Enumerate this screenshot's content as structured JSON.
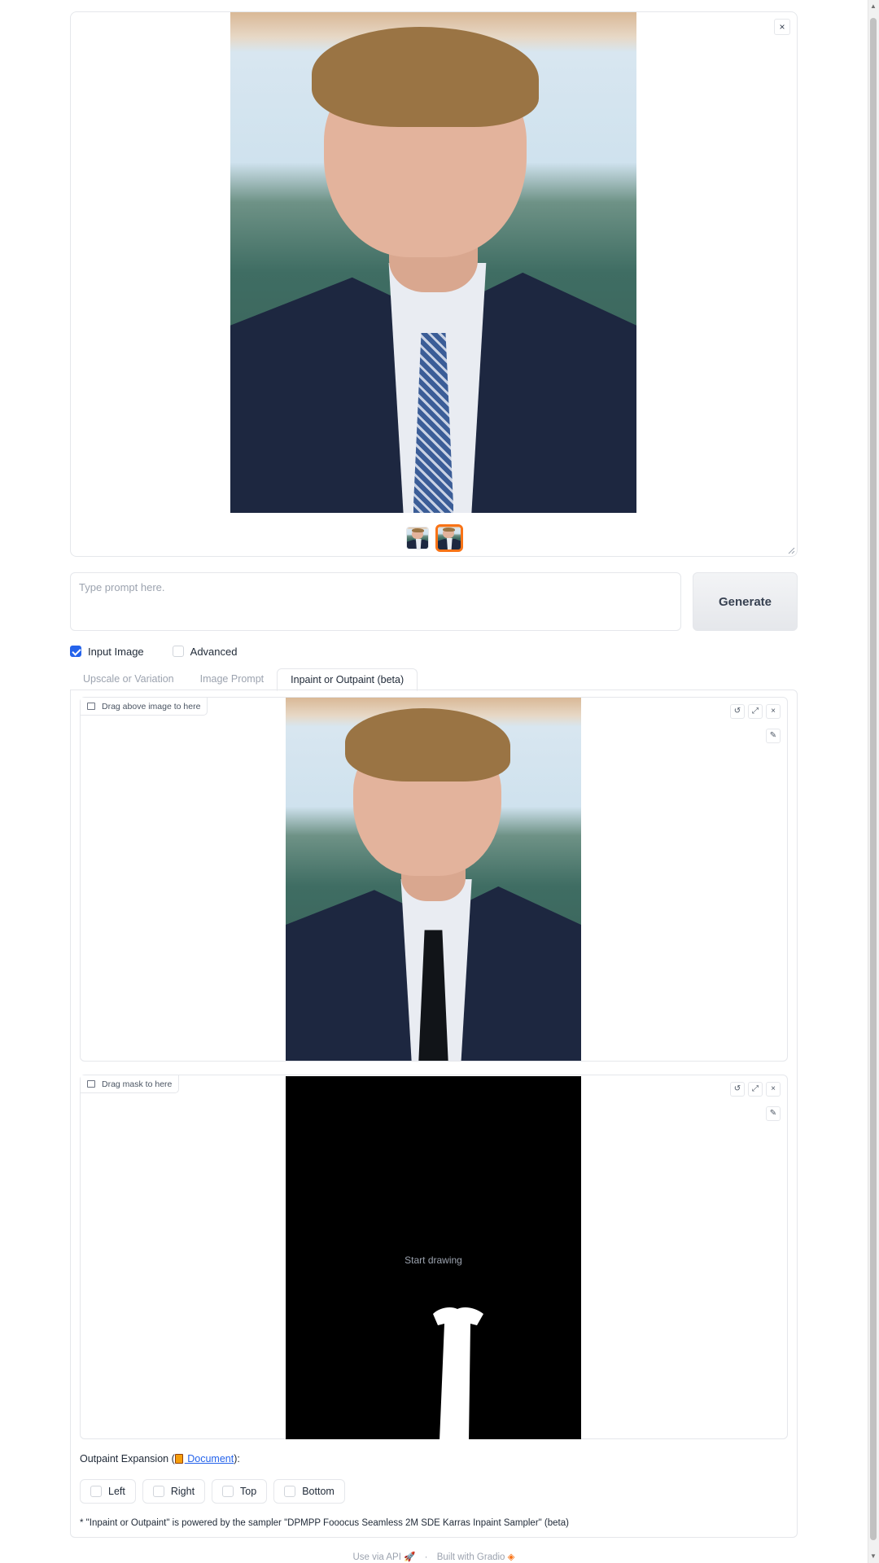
{
  "gallery": {
    "close_label": "×",
    "thumbnails": [
      "thumb-1",
      "thumb-2"
    ]
  },
  "prompt": {
    "placeholder": "Type prompt here."
  },
  "generate_label": "Generate",
  "options": {
    "input_image_label": "Input Image",
    "input_image_checked": true,
    "advanced_label": "Advanced",
    "advanced_checked": false
  },
  "tabs": [
    {
      "label": "Upscale or Variation",
      "active": false
    },
    {
      "label": "Image Prompt",
      "active": false
    },
    {
      "label": "Inpaint or Outpaint (beta)",
      "active": true
    }
  ],
  "image_editor": {
    "label": "Drag above image to here"
  },
  "mask_editor": {
    "label": "Drag mask to here",
    "hint": "Start drawing"
  },
  "outpaint": {
    "prefix": "Outpaint Expansion (",
    "link_label": " Document",
    "suffix": "):",
    "options": [
      "Left",
      "Right",
      "Top",
      "Bottom"
    ]
  },
  "footnote": "* \"Inpaint or Outpaint\" is powered by the sampler \"DPMPP Fooocus Seamless 2M SDE Karras Inpaint Sampler\" (beta)",
  "footer": {
    "api_label": "Use via API",
    "sep": "·",
    "built_label": "Built with Gradio"
  },
  "colors": {
    "accent": "#f97316",
    "checkbox": "#2563eb",
    "link": "#2563eb"
  }
}
